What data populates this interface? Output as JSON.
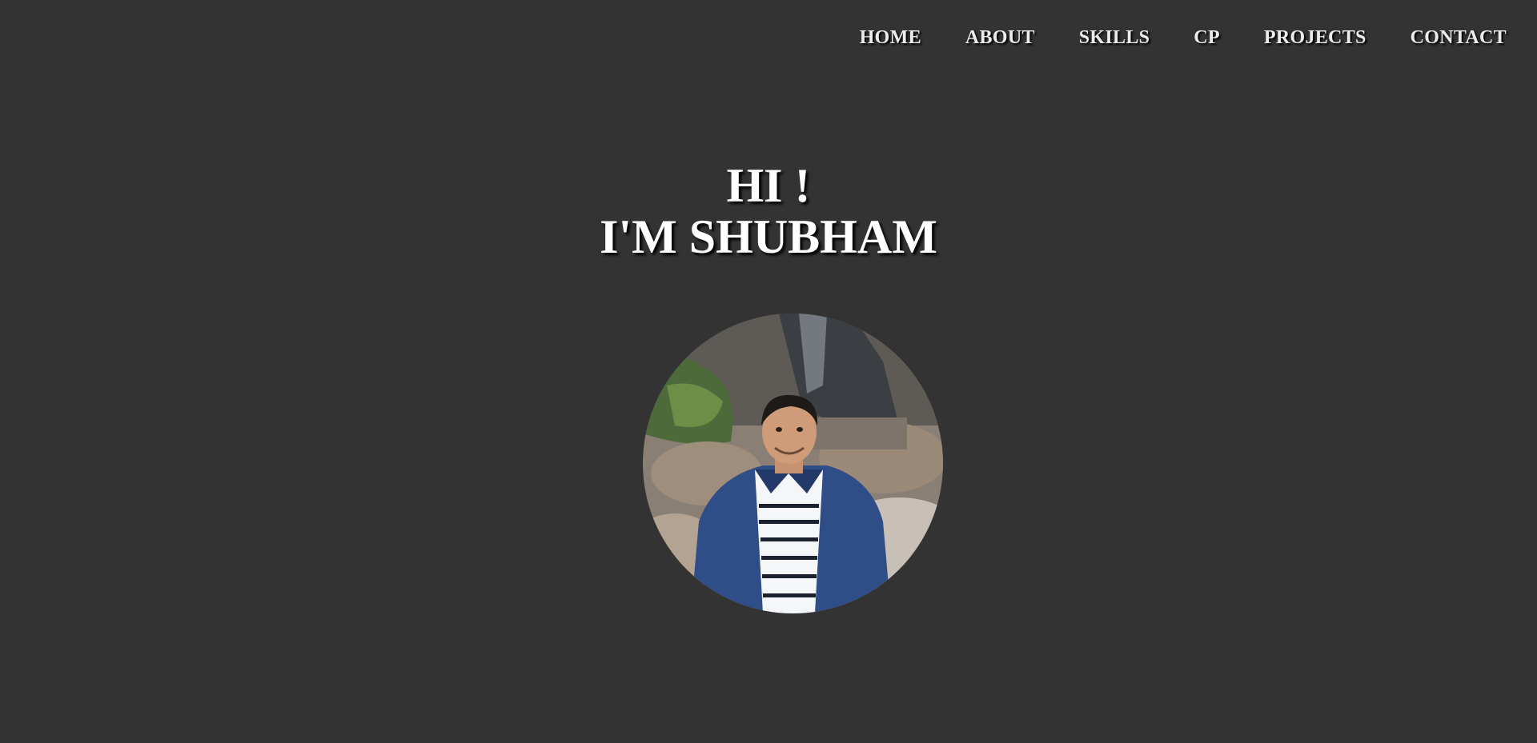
{
  "nav": {
    "items": [
      {
        "label": "HOME"
      },
      {
        "label": "ABOUT"
      },
      {
        "label": "SKILLS"
      },
      {
        "label": "CP"
      },
      {
        "label": "PROJECTS"
      },
      {
        "label": "CONTACT"
      }
    ]
  },
  "hero": {
    "greeting": "HI !",
    "name_line": "I'M SHUBHAM"
  },
  "colors": {
    "background": "#333333",
    "text": "#ffffff",
    "nav_text": "#ececec"
  }
}
